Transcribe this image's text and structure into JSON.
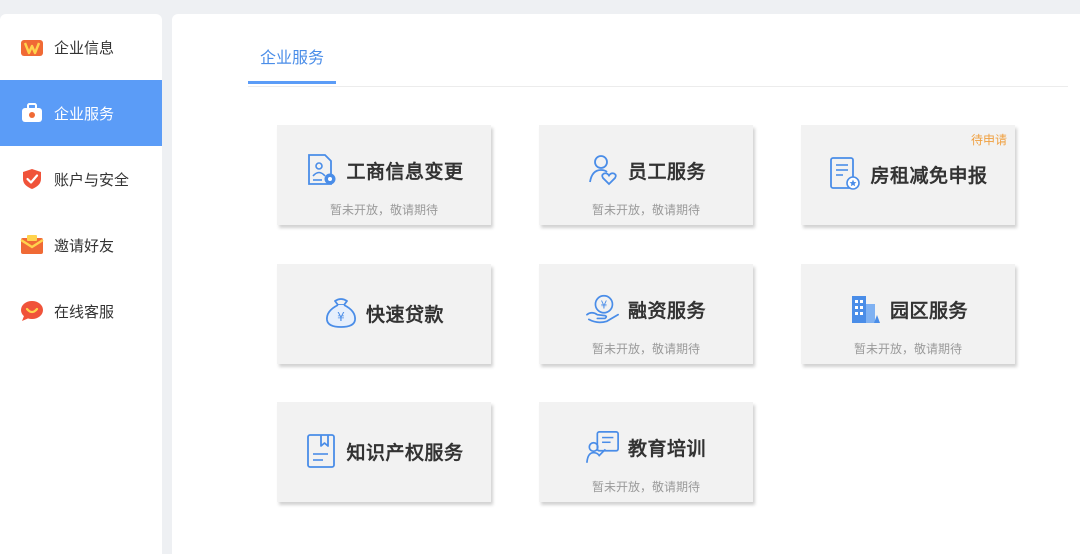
{
  "sidebar": {
    "items": [
      {
        "label": "企业信息",
        "icon": "company-info-icon",
        "active": false
      },
      {
        "label": "企业服务",
        "icon": "briefcase-icon",
        "active": true
      },
      {
        "label": "账户与安全",
        "icon": "shield-icon",
        "active": false
      },
      {
        "label": "邀请好友",
        "icon": "envelope-icon",
        "active": false
      },
      {
        "label": "在线客服",
        "icon": "chat-bubble-icon",
        "active": false
      }
    ]
  },
  "main": {
    "tab": "企业服务",
    "cards": [
      {
        "title": "工商信息变更",
        "subtitle": "暂未开放，敬请期待",
        "icon": "document-user-icon"
      },
      {
        "title": "员工服务",
        "subtitle": "暂未开放，敬请期待",
        "icon": "employee-heart-icon"
      },
      {
        "title": "房租减免申报",
        "subtitle": "",
        "badge": "待申请",
        "icon": "document-badge-icon"
      },
      {
        "title": "快速贷款",
        "subtitle": "",
        "icon": "money-bag-icon"
      },
      {
        "title": "融资服务",
        "subtitle": "暂未开放，敬请期待",
        "icon": "yen-hand-icon"
      },
      {
        "title": "园区服务",
        "subtitle": "暂未开放，敬请期待",
        "icon": "building-icon"
      },
      {
        "title": "知识产权服务",
        "subtitle": "",
        "icon": "bookmark-doc-icon"
      },
      {
        "title": "教育培训",
        "subtitle": "暂未开放，敬请期待",
        "icon": "teacher-board-icon"
      }
    ]
  },
  "colors": {
    "accent": "#5b9cf7",
    "icon_blue": "#4a8de8",
    "badge": "#f0a040"
  }
}
